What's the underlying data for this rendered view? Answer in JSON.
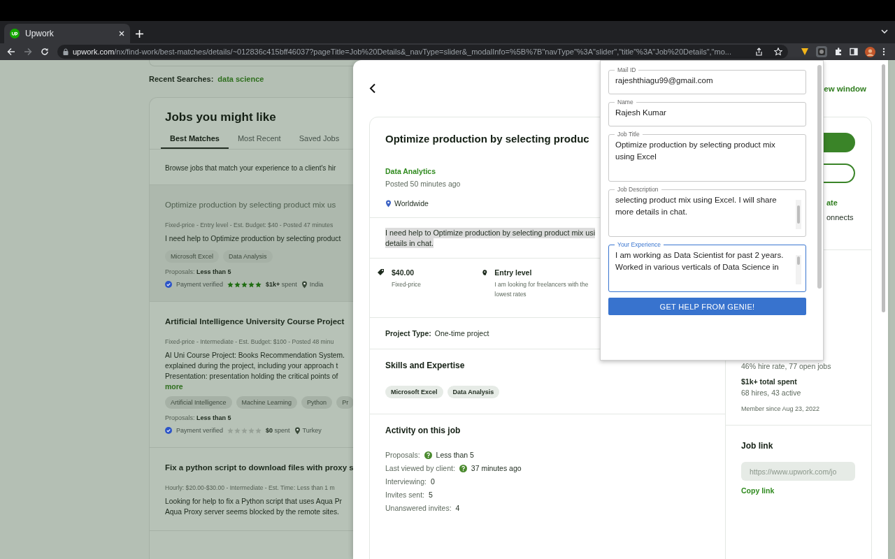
{
  "browser": {
    "tab": {
      "title": "Upwork",
      "selected": true
    },
    "url_host": "upwork.com",
    "url_path": "/nx/find-work/best-matches/details/~012836c415bff46037?pageTitle=Job%20Details&_navType=slider&_modalInfo=%5B%7B\"navType\"%3A\"slider\",\"title\"%3A\"Job%20Details\",\"mo..."
  },
  "page": {
    "recent_label": "Recent Searches:",
    "recent_link": "data science",
    "heading": "Jobs you might like",
    "tabs": [
      {
        "label": "Best Matches",
        "selected": true
      },
      {
        "label": "Most Recent",
        "selected": false
      },
      {
        "label": "Saved Jobs",
        "selected": false
      }
    ],
    "intro": "Browse jobs that match your experience to a client's hir",
    "jobs": [
      {
        "highlighted": true,
        "title": "Optimize production by selecting product mix us",
        "meta": "Fixed-price - Entry level - Est. Budget: $40 - Posted 47 minutes",
        "description_lines": [
          "I need help to Optimize production by selecting product"
        ],
        "skills": [
          "Microsoft Excel",
          "Data Analysis"
        ],
        "proposals_label": "Proposals:",
        "proposals_value": "Less than 5",
        "payment": "Payment verified",
        "stars": 5,
        "spent_amount": "$1k+",
        "spent_label": "spent",
        "country": "India"
      },
      {
        "highlighted": false,
        "title": "Artificial Intelligence University Course Project",
        "meta": "Fixed-price - Intermediate - Est. Budget: $100 - Posted 48 minu",
        "description_lines": [
          "AI Uni Course Project: Books Recommendation System.",
          "explained during the project, including your approach t",
          "Presentation: presentation holding the critical points of"
        ],
        "more": "more",
        "skills": [
          "Artificial Intelligence",
          "Machine Learning",
          "Python",
          "Pr"
        ],
        "proposals_label": "Proposals:",
        "proposals_value": "Less than 5",
        "payment": "Payment verified",
        "stars": 0,
        "spent_amount": "$0",
        "spent_label": "spent",
        "country": "Turkey"
      },
      {
        "highlighted": false,
        "title": "Fix a python script to download files with proxy s",
        "meta": "Hourly: $20.00-$30.00 - Intermediate - Est. Time: Less than 1 m",
        "description_lines": [
          "Looking for help to fix a Python script that uses Aqua Pr",
          "Aqua Proxy server seems blocked by the remote sites."
        ]
      }
    ]
  },
  "panel": {
    "new_window_link": "ew window",
    "title": "Optimize production by selecting produc",
    "category": "Data Analytics",
    "posted": "Posted 50 minutes ago",
    "location": "Worldwide",
    "description_lines": [
      "I need help to Optimize production by selecting product mix usi",
      "details in chat."
    ],
    "features": [
      {
        "kind": "price",
        "value": "$40.00",
        "note": "Fixed-price"
      },
      {
        "kind": "level",
        "value": "Entry level",
        "note": "I am looking for freelancers with the lowest rates"
      }
    ],
    "project_type_label": "Project Type:",
    "project_type": "One-time project",
    "skills_heading": "Skills and Expertise",
    "skills": [
      "Microsoft Excel",
      "Data Analysis"
    ],
    "activity_heading": "Activity on this job",
    "activity": [
      {
        "label": "Proposals:",
        "value": "Less than 5",
        "help": true
      },
      {
        "label": "Last viewed by client:",
        "value": "37 minutes ago",
        "help": true
      },
      {
        "label": "Interviewing:",
        "value": "0",
        "help": false
      },
      {
        "label": "Invites sent:",
        "value": "5",
        "help": false
      },
      {
        "label": "Unanswered invites:",
        "value": "4",
        "help": false
      }
    ],
    "side_links": [
      "ate",
      "onnects"
    ],
    "client": {
      "hire_rate": "46% hire rate, 77 open jobs",
      "total_spent": "$1k+ total spent",
      "hires": "68 hires, 43 active",
      "member_since": "Member since Aug 23, 2022"
    },
    "job_link_heading": "Job link",
    "job_link": "https://www.upwork.com/jo",
    "copy_link": "Copy link"
  },
  "popup": {
    "fields": [
      {
        "label": "Mail ID",
        "value": "rajeshthiagu99@gmail.com",
        "focused": false,
        "multiline": false
      },
      {
        "label": "Name",
        "value": "Rajesh Kumar",
        "focused": false,
        "multiline": false
      },
      {
        "label": "Job Title",
        "value": "Optimize production by selecting product mix using Excel",
        "focused": false,
        "multiline": true
      },
      {
        "label": "Job Description",
        "value": "selecting product mix using Excel. I will share more details in chat.",
        "focused": false,
        "multiline": true
      },
      {
        "label": "Your Experience",
        "value": "I am working as Data Scientist for past 2 years.\nWorked in various verticals of Data Science in",
        "focused": true,
        "multiline": true
      }
    ],
    "button": "GET HELP FROM GENIE!"
  }
}
